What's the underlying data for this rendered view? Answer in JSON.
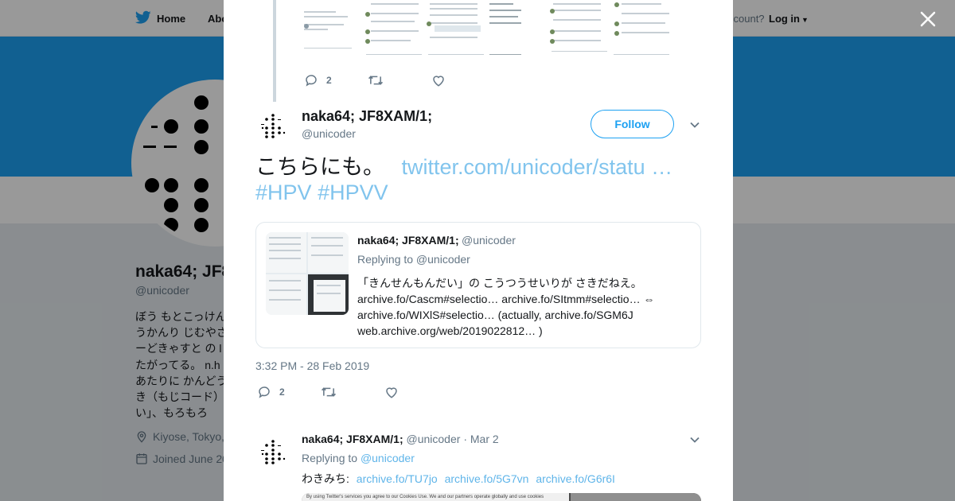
{
  "nav": {
    "home": "Home",
    "about": "Abo",
    "account_prompt": "ccount?",
    "login": "Log in"
  },
  "profile": {
    "name": "naka64; JF8",
    "handle": "@unicoder",
    "bio_lines": [
      "ぼう もとこっけん",
      "うかんり じむやさ",
      "ーどきゃすと の l",
      "たがってる。 n.h",
      "あたりに かんどう",
      "き（もじコード）",
      "い」、もろもろ"
    ],
    "location": "Kiyose, Tokyo,",
    "joined": "Joined June 20"
  },
  "previous_tweet": {
    "reply_count": "2",
    "retweet_count": "",
    "like_count": ""
  },
  "main_tweet": {
    "author_name": "naka64; JF8XAM/1;",
    "author_handle": "@unicoder",
    "follow_label": "Follow",
    "text": "こちらにも。",
    "link": "twitter.com/unicoder/statu …",
    "hashtag1": "#HPV",
    "hashtag2": "#HPVV",
    "quote": {
      "name": "naka64; JF8XAM/1;",
      "handle": "@unicoder",
      "replying_to": "Replying to @unicoder",
      "line1": "「きんせんもんだい」の こうつうせいりが さきだねえ。",
      "line2": "archive.fo/Cascm#selectio… archive.fo/SItmm#selectio… ⇔",
      "line3": "archive.fo/WIXlS#selectio… (actually, archive.fo/SGM6J",
      "line4": "web.archive.org/web/2019022812… )"
    },
    "timestamp": "3:32 PM - 28 Feb 2019",
    "reply_count": "2",
    "retweet_count": "",
    "like_count": ""
  },
  "reply_tweet": {
    "author_name": "naka64; JF8XAM/1;",
    "author_handle": "@unicoder",
    "date": "· Mar 2",
    "replying_label": "Replying to",
    "replying_handle": "@unicoder",
    "text_prefix": "わきみち:",
    "link1": "archive.fo/TU7jo",
    "link2": "archive.fo/5G7vn",
    "link3": "archive.fo/G6r6I",
    "media_text_left": "By using Twitter's services you agree to our Cookies Use. We and our partners operate globally and use cookies"
  },
  "colors": {
    "accent": "#1da1f2",
    "link": "#1b95e0",
    "muted": "#657786",
    "overlay": "rgba(0,0,0,0.40)"
  }
}
